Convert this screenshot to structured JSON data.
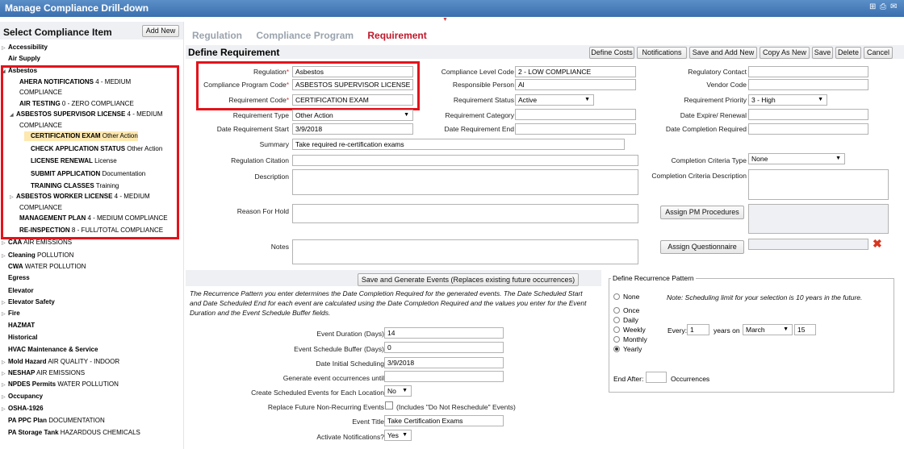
{
  "title": "Manage Compliance Drill-down",
  "left": {
    "title": "Select Compliance Item",
    "add_new": "Add New",
    "items": [
      {
        "t": "▷",
        "b": "Accessibility",
        "r": ""
      },
      {
        "t": "",
        "b": "Air Supply",
        "r": ""
      },
      {
        "t": "◢",
        "b": "Asbestos",
        "r": ""
      },
      {
        "t": "",
        "b": "AHERA NOTIFICATIONS",
        "r": " 4 - MEDIUM"
      },
      {
        "t": "",
        "b": "",
        "r": "COMPLIANCE"
      },
      {
        "t": "",
        "b": "AIR TESTING",
        "r": " 0 - ZERO COMPLIANCE"
      },
      {
        "t": "◢",
        "b": "ASBESTOS SUPERVISOR LICENSE",
        "r": " 4 - MEDIUM"
      },
      {
        "t": "",
        "b": "",
        "r": "COMPLIANCE"
      },
      {
        "t": "",
        "b": "CERTIFICATION EXAM",
        "r": " Other Action"
      },
      {
        "t": "",
        "b": "CHECK APPLICATION STATUS",
        "r": " Other Action"
      },
      {
        "t": "",
        "b": "LICENSE RENEWAL",
        "r": " License"
      },
      {
        "t": "",
        "b": "SUBMIT APPLICATION",
        "r": " Documentation"
      },
      {
        "t": "",
        "b": "TRAINING CLASSES",
        "r": " Training"
      },
      {
        "t": "▷",
        "b": "ASBESTOS WORKER LICENSE",
        "r": " 4 - MEDIUM"
      },
      {
        "t": "",
        "b": "",
        "r": "COMPLIANCE"
      },
      {
        "t": "",
        "b": "MANAGEMENT PLAN",
        "r": " 4 - MEDIUM COMPLIANCE"
      },
      {
        "t": "",
        "b": "RE-INSPECTION",
        "r": " 8 - FULL/TOTAL COMPLIANCE"
      },
      {
        "t": "▷",
        "b": "CAA",
        "r": " AIR EMISSIONS"
      },
      {
        "t": "▷",
        "b": "Cleaning",
        "r": " POLLUTION"
      },
      {
        "t": "",
        "b": "CWA",
        "r": " WATER POLLUTION"
      },
      {
        "t": "",
        "b": "Egress",
        "r": ""
      },
      {
        "t": "",
        "b": "Elevator",
        "r": ""
      },
      {
        "t": "▷",
        "b": "Elevator Safety",
        "r": ""
      },
      {
        "t": "▷",
        "b": "Fire",
        "r": ""
      },
      {
        "t": "",
        "b": "HAZMAT",
        "r": ""
      },
      {
        "t": "",
        "b": "Historical",
        "r": ""
      },
      {
        "t": "",
        "b": "HVAC Maintenance & Service",
        "r": ""
      },
      {
        "t": "▷",
        "b": "Mold Hazard",
        "r": " AIR QUALITY - INDOOR"
      },
      {
        "t": "▷",
        "b": "NESHAP",
        "r": " AIR EMISSIONS"
      },
      {
        "t": "▷",
        "b": "NPDES Permits",
        "r": " WATER POLLUTION"
      },
      {
        "t": "▷",
        "b": "Occupancy",
        "r": ""
      },
      {
        "t": "▷",
        "b": "OSHA-1926",
        "r": ""
      },
      {
        "t": "",
        "b": "PA PPC Plan",
        "r": " DOCUMENTATION"
      },
      {
        "t": "",
        "b": "PA Storage Tank",
        "r": " HAZARDOUS CHEMICALS"
      }
    ]
  },
  "tabs": [
    "Regulation",
    "Compliance Program",
    "Requirement"
  ],
  "section_title": "Define Requirement",
  "toolbar": [
    "Define Costs",
    "Notifications",
    "Save and Add New",
    "Copy As New",
    "Save",
    "Delete",
    "Cancel"
  ],
  "form": {
    "regulation_label": "Regulation",
    "regulation": "Asbestos",
    "program_label": "Compliance Program Code",
    "program": "ASBESTOS SUPERVISOR LICENSE",
    "req_code_label": "Requirement Code",
    "req_code": "CERTIFICATION EXAM",
    "req_type_label": "Requirement Type",
    "req_type": "Other Action",
    "date_start_label": "Date Requirement Start",
    "date_start": "3/9/2018",
    "summary_label": "Summary",
    "summary": "Take required re-certification exams",
    "citation_label": "Regulation Citation",
    "description_label": "Description",
    "reason_label": "Reason For Hold",
    "notes_label": "Notes",
    "level_label": "Compliance Level Code",
    "level": "2 - LOW COMPLIANCE",
    "person_label": "Responsible Person",
    "person": "Al",
    "status_label": "Requirement Status",
    "status": "Active",
    "category_label": "Requirement Category",
    "date_end_label": "Date Requirement End",
    "contact_label": "Regulatory Contact",
    "vendor_label": "Vendor Code",
    "priority_label": "Requirement Priority",
    "priority": "3 - High",
    "expire_label": "Date Expire/ Renewal",
    "completion_req_label": "Date Completion Required",
    "criteria_type_label": "Completion Criteria Type",
    "criteria_type": "None",
    "criteria_desc_label": "Completion Criteria Description",
    "assign_pm": "Assign PM Procedures",
    "assign_q": "Assign Questionnaire"
  },
  "recurrence": {
    "save_gen": "Save and Generate Events (Replaces existing future occurrences)",
    "note": "The Recurrence Pattern you enter determines the Date Completion Required for the generated events. The Date Scheduled Start and Date Scheduled End for each event are calculated using the Date Completion Required and the values you enter for the Event Duration and the Event Schedule Buffer fields.",
    "duration_label": "Event Duration (Days)",
    "duration": "14",
    "buffer_label": "Event Schedule Buffer (Days)",
    "buffer": "0",
    "initial_label": "Date Initial Scheduling",
    "initial": "3/9/2018",
    "until_label": "Generate event occurrences until",
    "create_label": "Create Scheduled Events for Each Location",
    "create": "No",
    "replace_label": "Replace Future Non-Recurring Events",
    "replace_note": "(Includes \"Do Not Reschedule\" Events)",
    "event_title_label": "Event Title",
    "event_title": "Take Certification Exams",
    "activate_label": "Activate Notifications?",
    "activate": "Yes"
  },
  "pattern": {
    "legend": "Define Recurrence Pattern",
    "options": [
      "None",
      "Once",
      "Daily",
      "Weekly",
      "Monthly",
      "Yearly"
    ],
    "selected": "Yearly",
    "limit_note": "Note: Scheduling limit for your selection is 10 years in the future.",
    "every_label": "Every:",
    "every": "1",
    "years_on": "years on",
    "month": "March",
    "day": "15",
    "end_after": "End After:",
    "occurrences": "Occurrences"
  }
}
